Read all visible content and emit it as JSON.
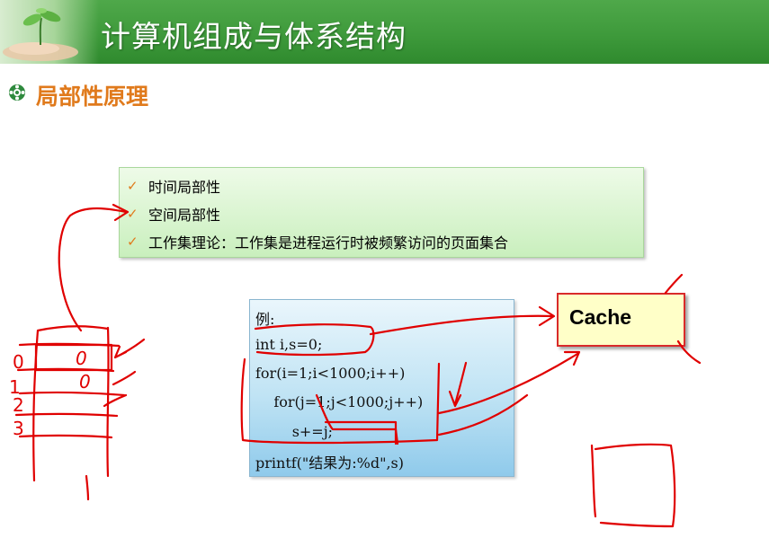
{
  "header": {
    "title": "计算机组成与体系结构"
  },
  "section": {
    "title": "局部性原理",
    "bullet_icon": "flower-bullet-icon"
  },
  "concepts": {
    "check_icon": "checkmark-icon",
    "items": [
      "时间局部性",
      "空间局部性",
      "工作集理论：工作集是进程运行时被频繁访问的页面集合"
    ]
  },
  "code": {
    "lines": [
      "例:",
      "int i,s=0;",
      "for(i=1;i<1000;i++)",
      "    for(j=1;j<1000;j++)",
      "        s+=j;",
      "printf(\"结果为:%d\",s)"
    ]
  },
  "cache": {
    "label": "Cache"
  },
  "annotations": {
    "ink_color": "#e00000",
    "row_numbers": [
      "0",
      "1",
      "2",
      "3"
    ],
    "cell_marks": [
      "0",
      "0"
    ]
  },
  "colors": {
    "header_green": "#3e9a3b",
    "section_orange": "#e07a1c",
    "concept_box_green": "#c9efbd",
    "code_box_blue": "#bfe3f4",
    "cache_fill": "#ffffc8",
    "cache_border": "#d92a2a"
  }
}
